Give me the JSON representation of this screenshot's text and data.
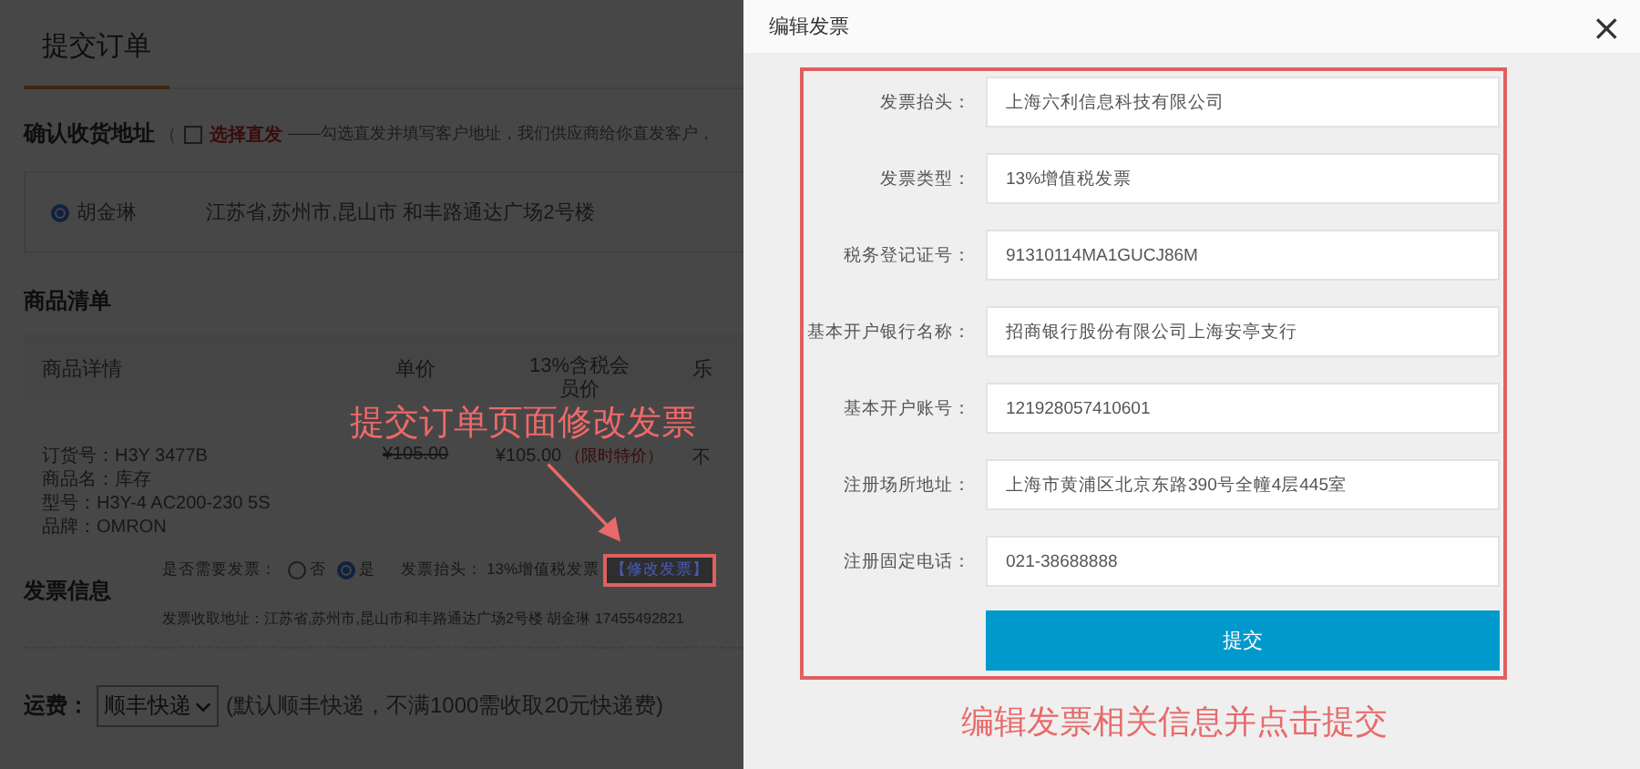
{
  "page": {
    "title": "提交订单",
    "address": {
      "label": "确认收货地址",
      "bracket": "（",
      "direct_ship": {
        "label": "选择直发",
        "checked": false
      },
      "hint": "——勾选直发并填写客户地址，我们供应商给你直发客户，",
      "entries": [
        {
          "name": "胡金琳",
          "address": "江苏省,苏州市,昆山市 和丰路通达广场2号楼",
          "selected": true
        }
      ]
    },
    "goods": {
      "title": "商品清单",
      "columns": [
        "商品详情",
        "单价",
        "13%含税会员价",
        "乐"
      ],
      "rows": [
        {
          "details": [
            "订货号：H3Y 3477B",
            "商品名：库存",
            "型号：H3Y-4 AC200-230 5S",
            "品牌：OMRON"
          ],
          "original_price": "¥105.00",
          "price": "¥105.00",
          "price_note": "（限时特价）",
          "column_4": "不"
        }
      ]
    },
    "invoice": {
      "title": "发票信息",
      "need_label": "是否需要发票：",
      "options": [
        {
          "label": "否",
          "selected": false
        },
        {
          "label": "是",
          "selected": true
        }
      ],
      "header_label": "发票抬头：",
      "header_value": "13%增值税发票",
      "edit_link": "【修改发票】",
      "address_label": "发票收取地址：",
      "address_value": "江苏省,苏州市,昆山市和丰路通达广场2号楼 胡金琳 17455492821"
    },
    "shipping": {
      "label": "运费：",
      "selected": "顺丰快递",
      "note": "(默认顺丰快递，不满1000需收取20元快递费)"
    }
  },
  "callout_left": "提交订单页面修改发票",
  "dialog": {
    "title": "编辑发票",
    "close": "×",
    "fields": [
      {
        "label": "发票抬头：",
        "value": "上海六利信息科技有限公司"
      },
      {
        "label": "发票类型：",
        "value": "13%增值税发票"
      },
      {
        "label": "税务登记证号：",
        "value": "91310114MA1GUCJ86M"
      },
      {
        "label": "基本开户银行名称：",
        "value": "招商银行股份有限公司上海安亭支行"
      },
      {
        "label": "基本开户账号：",
        "value": "121928057410601"
      },
      {
        "label": "注册场所地址：",
        "value": "上海市黄浦区北京东路390号全幢4层445室"
      },
      {
        "label": "注册固定电话：",
        "value": "021-38688888"
      }
    ],
    "submit": "提交"
  },
  "callout_right": "编辑发票相关信息并点击提交"
}
